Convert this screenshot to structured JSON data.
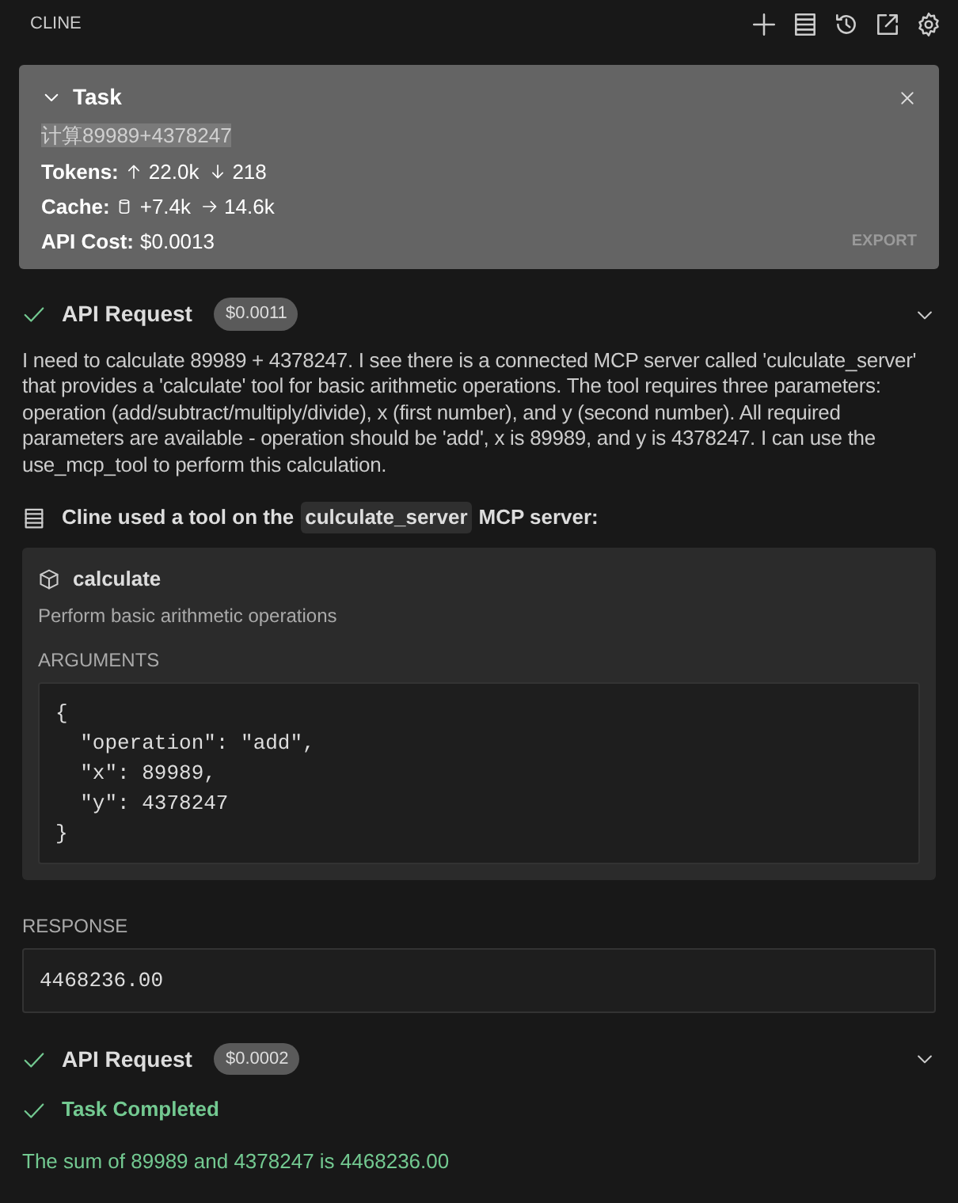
{
  "header": {
    "title": "CLINE"
  },
  "task": {
    "label": "Task",
    "expanded": true,
    "prompt": "计算89989+4378247",
    "prompt_highlighted": true,
    "stats": [
      {
        "kind": "tokens",
        "label": "Tokens:",
        "in": "22.0k",
        "out": "218"
      },
      {
        "kind": "cache",
        "label": "Cache:",
        "write": "+7.4k",
        "read": "14.6k"
      },
      {
        "kind": "cost",
        "label": "API Cost:",
        "value": "$0.0013"
      }
    ],
    "export": "EXPORT"
  },
  "messages": [
    {
      "kind": "api_request",
      "label": "API Request",
      "cost": "$0.0011",
      "done": true
    },
    {
      "kind": "text",
      "text": "I need to calculate 89989 + 4378247. I see there is a connected MCP server called 'culculate_server' that provides a 'calculate' tool for basic arithmetic operations. The tool requires three parameters: operation (add/subtract/multiply/divide), x (first number), and y (second number). All required parameters are available - operation should be 'add', x is 89989, and y is 4378247. I can use the use_mcp_tool to perform this calculation."
    },
    {
      "kind": "tool_use",
      "prefix": "Cline used a tool on the",
      "server": "culculate_server",
      "suffix": "MCP server:",
      "tool_name": "calculate",
      "description": "Perform basic arithmetic operations",
      "arguments_label": "ARGUMENTS",
      "arguments": "{\n  \"operation\": \"add\",\n  \"x\": 89989,\n  \"y\": 4378247\n}"
    },
    {
      "kind": "response",
      "label": "RESPONSE",
      "value": "4468236.00"
    },
    {
      "kind": "api_request",
      "label": "API Request",
      "cost": "$0.0002",
      "done": true
    },
    {
      "kind": "completion",
      "label": "Task Completed",
      "text": "The sum of 89989 and 4378247 is 4468236.00"
    }
  ]
}
